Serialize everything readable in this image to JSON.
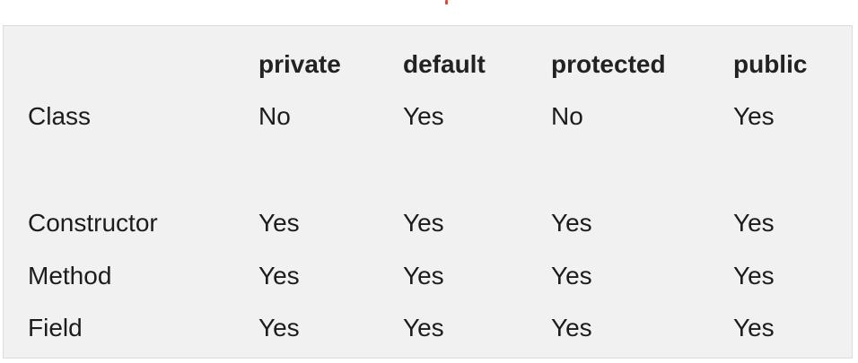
{
  "table": {
    "headers": [
      "private",
      "default",
      "protected",
      "public"
    ],
    "rows": [
      {
        "label": "Class",
        "values": [
          "No",
          "Yes",
          "No",
          "Yes"
        ]
      },
      {
        "label": "Constructor",
        "values": [
          "Yes",
          "Yes",
          "Yes",
          "Yes"
        ]
      },
      {
        "label": "Method",
        "values": [
          "Yes",
          "Yes",
          "Yes",
          "Yes"
        ]
      },
      {
        "label": "Field",
        "values": [
          "Yes",
          "Yes",
          "Yes",
          "Yes"
        ]
      }
    ]
  },
  "colors": {
    "panel_background": "#f1f1f1",
    "panel_border": "#dcdcdc",
    "text": "#1c1c1c",
    "marker_dot": "#e0463c"
  }
}
